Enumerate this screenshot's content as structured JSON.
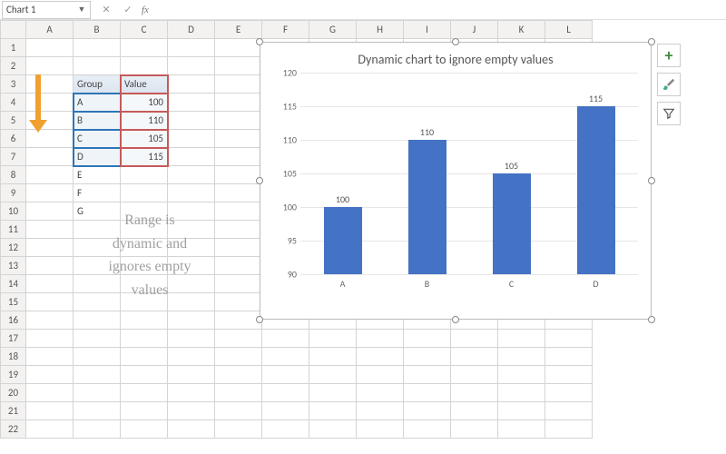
{
  "namebox": {
    "value": "Chart 1"
  },
  "fx": {
    "cancel": "✕",
    "check": "✓",
    "label": "fx"
  },
  "columns": [
    "A",
    "B",
    "C",
    "D",
    "E",
    "F",
    "G",
    "H",
    "I",
    "J",
    "K",
    "L"
  ],
  "rows": [
    "1",
    "2",
    "3",
    "4",
    "5",
    "6",
    "7",
    "8",
    "9",
    "10",
    "11",
    "12",
    "13",
    "14",
    "15",
    "16",
    "17",
    "18",
    "19",
    "20",
    "21",
    "22"
  ],
  "table": {
    "header_group": "Group",
    "header_value": "Value",
    "rows": [
      {
        "g": "A",
        "v": "100"
      },
      {
        "g": "B",
        "v": "110"
      },
      {
        "g": "C",
        "v": "105"
      },
      {
        "g": "D",
        "v": "115"
      },
      {
        "g": "E",
        "v": ""
      },
      {
        "g": "F",
        "v": ""
      },
      {
        "g": "G",
        "v": ""
      }
    ]
  },
  "annotation": {
    "l1": "Range is",
    "l2": "dynamic and",
    "l3": "ignores empty",
    "l4": "values"
  },
  "chart_data": {
    "type": "bar",
    "title": "Dynamic chart to ignore empty values",
    "categories": [
      "A",
      "B",
      "C",
      "D"
    ],
    "values": [
      100,
      110,
      105,
      115
    ],
    "value_labels": [
      "100",
      "110",
      "105",
      "115"
    ],
    "ylim": [
      90,
      120
    ],
    "yticks": [
      "90",
      "95",
      "100",
      "105",
      "110",
      "115",
      "120"
    ],
    "xlabel": "",
    "ylabel": ""
  },
  "tools": {
    "plus": "+",
    "brush": "brush-icon",
    "filter": "funnel-icon"
  }
}
